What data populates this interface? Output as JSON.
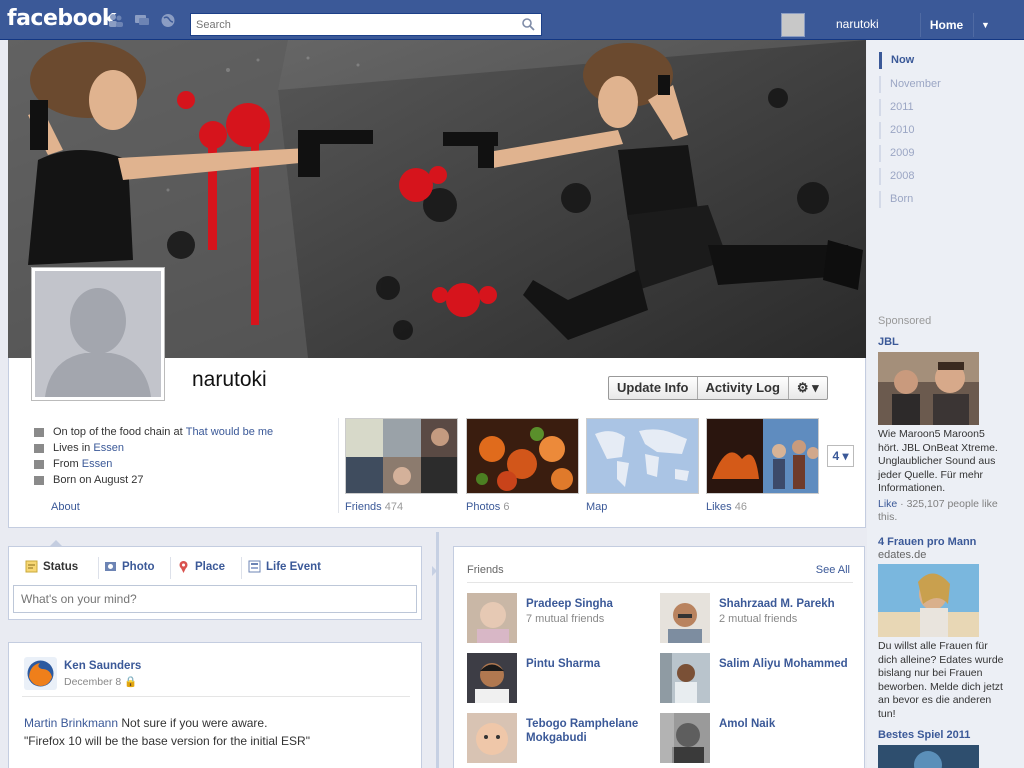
{
  "topbar": {
    "logo": "facebook",
    "search_placeholder": "Search",
    "user_name": "narutoki",
    "home_label": "Home",
    "home_caret": "▼"
  },
  "profile": {
    "name": "narutoki",
    "actions": {
      "update_info": "Update Info",
      "activity_log": "Activity Log",
      "settings": "⚙ ▾"
    },
    "info": [
      {
        "prefix": "On top of the food chain at ",
        "link": "That would be me"
      },
      {
        "prefix": "Lives in ",
        "link": "Essen"
      },
      {
        "prefix": "From ",
        "link": "Essen"
      },
      {
        "prefix": "Born on August 27",
        "link": ""
      }
    ],
    "about": "About",
    "tiles": [
      {
        "label": "Friends",
        "count": "474"
      },
      {
        "label": "Photos",
        "count": "6"
      },
      {
        "label": "Map",
        "count": ""
      },
      {
        "label": "Likes",
        "count": "46"
      }
    ],
    "more_count": "4 ▾"
  },
  "timeline_nav": [
    "Now",
    "November",
    "2011",
    "2010",
    "2009",
    "2008",
    "Born"
  ],
  "sponsored": {
    "heading": "Sponsored",
    "ads": [
      {
        "title": "JBL",
        "subtitle": "",
        "text": "Wie Maroon5 Maroon5 hört. JBL OnBeat Xtreme. Unglaublicher Sound aus jeder Quelle. Für mehr Informationen.",
        "like_link": "Like",
        "like_text": " · 325,107 people like this."
      },
      {
        "title": "4 Frauen pro Mann",
        "subtitle": "edates.de",
        "text": "Du willst alle Frauen für dich alleine? Edates wurde bislang nur bei Frauen beworben. Melde dich jetzt an bevor es die anderen tun!",
        "like_link": "",
        "like_text": ""
      },
      {
        "title": "Bestes Spiel 2011",
        "subtitle": "",
        "text": "",
        "like_link": "",
        "like_text": ""
      }
    ]
  },
  "composer": {
    "tabs": [
      "Status",
      "Photo",
      "Place",
      "Life Event"
    ],
    "placeholder": "What's on your mind?"
  },
  "post": {
    "author": "Ken Saunders",
    "date": "December 8",
    "mention": "Martin Brinkmann",
    "text1": " Not sure if you were aware.",
    "text2": "\"Firefox 10 will be the base version for the initial ESR\""
  },
  "friends_box": {
    "heading": "Friends",
    "see_all": "See All",
    "friends": [
      {
        "name": "Pradeep Singha",
        "mutual": "7 mutual friends"
      },
      {
        "name": "Shahrzaad M. Parekh",
        "mutual": "2 mutual friends"
      },
      {
        "name": "Pintu Sharma",
        "mutual": ""
      },
      {
        "name": "Salim Aliyu Mohammed",
        "mutual": ""
      },
      {
        "name": "Tebogo Ramphelane Mokgabudi",
        "mutual": ""
      },
      {
        "name": "Amol Naik",
        "mutual": ""
      }
    ]
  }
}
